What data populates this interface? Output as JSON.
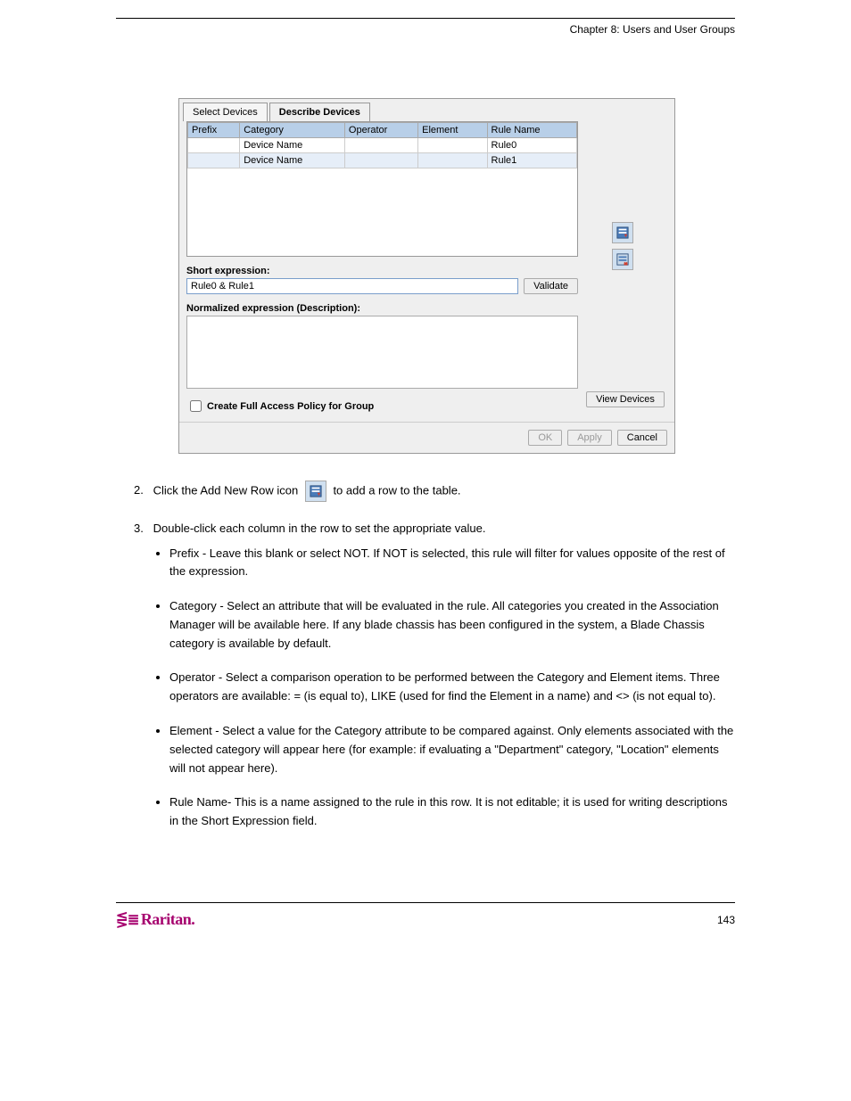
{
  "header": {
    "chapter": "Chapter 8: Users and User Groups"
  },
  "dialog": {
    "tabs": {
      "select": "Select Devices",
      "describe": "Describe Devices"
    },
    "columns": {
      "prefix": "Prefix",
      "category": "Category",
      "operator": "Operator",
      "element": "Element",
      "rulename": "Rule Name"
    },
    "rows": [
      {
        "prefix": "",
        "category": "Device Name",
        "operator": "",
        "element": "",
        "rulename": "Rule0"
      },
      {
        "prefix": "",
        "category": "Device Name",
        "operator": "",
        "element": "",
        "rulename": "Rule1"
      }
    ],
    "short_expr_label": "Short expression:",
    "short_expr_value": "Rule0 & Rule1",
    "validate": "Validate",
    "normalized_label": "Normalized expression (Description):",
    "view_devices": "View Devices",
    "checkbox_label": "Create Full Access Policy for Group",
    "buttons": {
      "ok": "OK",
      "apply": "Apply",
      "cancel": "Cancel"
    }
  },
  "steps": {
    "s2_prefix": "2.",
    "s2_a": "Click the Add New Row icon ",
    "s2_b": " to add a row to the table.",
    "s3_prefix": "3.",
    "s3": "Double-click each column in the row to set the appropriate value."
  },
  "bullets": {
    "b1": "Prefix - Leave this blank or select NOT. If NOT is selected, this rule will filter for values opposite of the rest of the expression.",
    "b2": "Category - Select an attribute that will be evaluated in the rule. All categories you created in the Association Manager will be available here. If any blade chassis has been configured in the system, a Blade Chassis category is available by default.",
    "b3": "Operator - Select a comparison operation to be performed between the Category and Element items. Three operators are available: = (is equal to), LIKE (used for find the Element in a name) and <> (is not equal to).",
    "b4": "Element - Select a value for the Category attribute to be compared against. Only elements associated with the selected category will appear here (for example: if evaluating a \"Department\" category, \"Location\" elements will not appear here).",
    "b5": "Rule Name- This is a name assigned to the rule in this row. It is not editable; it is used for writing descriptions in the Short Expression field."
  },
  "footer": {
    "logo": "Raritan.",
    "pagenum": "143"
  }
}
